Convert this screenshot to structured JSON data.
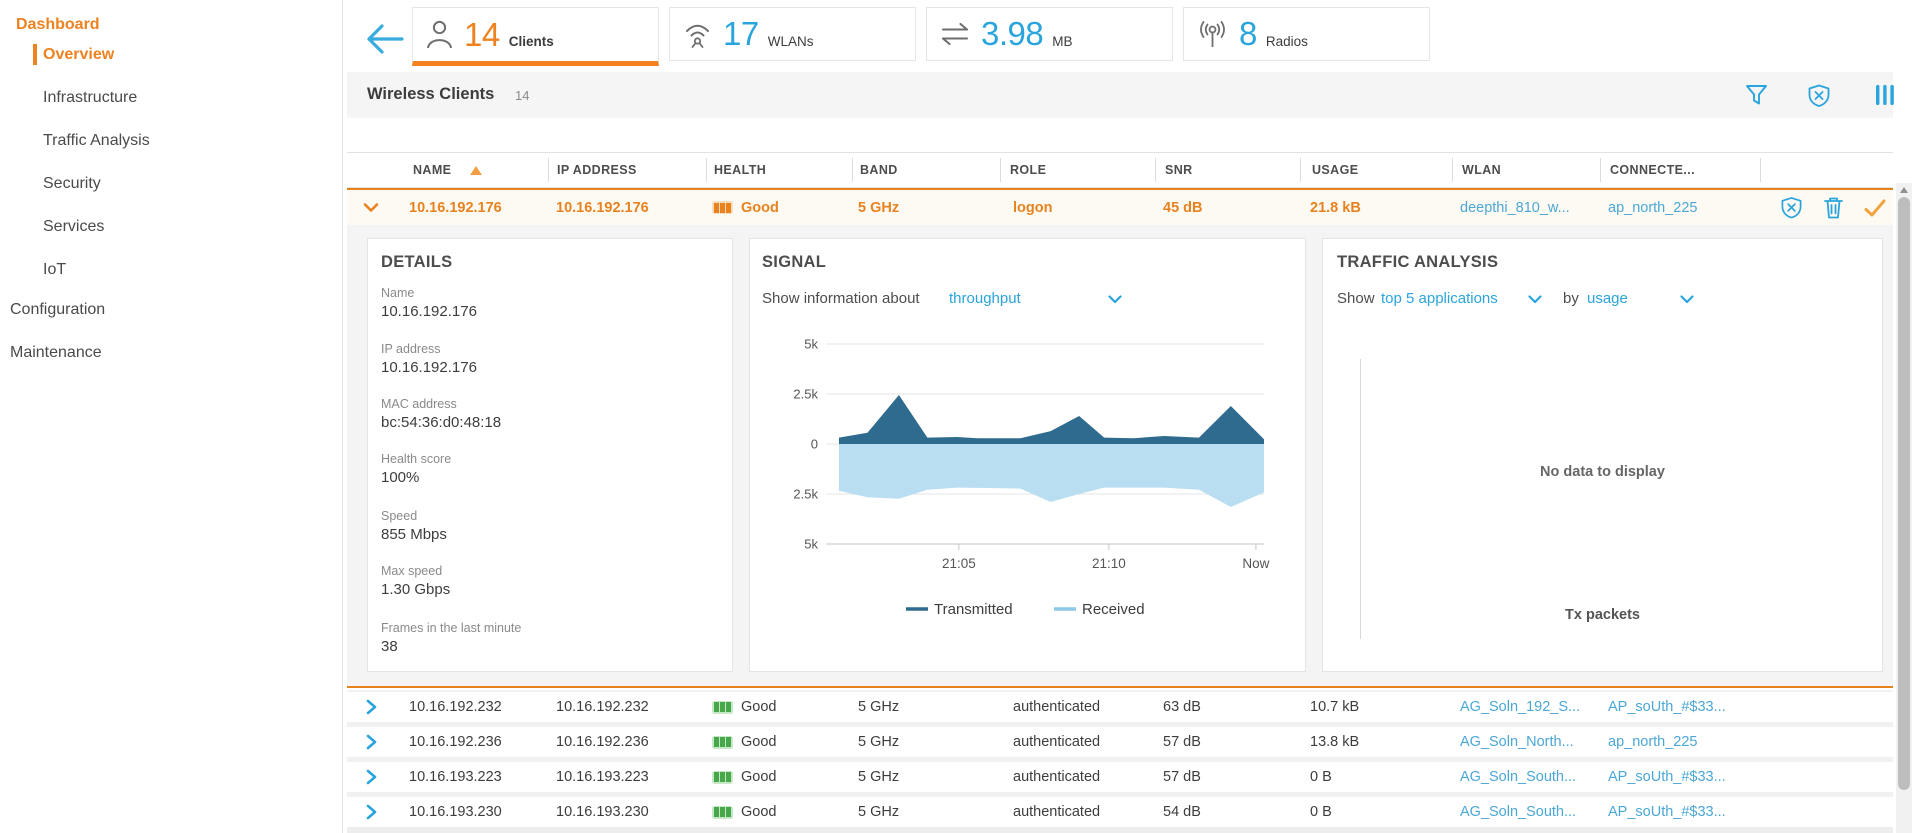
{
  "accent_colors": {
    "orange": "#ef8220",
    "blue": "#2aa4dc",
    "link_blue": "#4ba7d6",
    "green": "#4caf50"
  },
  "sidebar": {
    "items": [
      {
        "label": "Dashboard"
      },
      {
        "label": "Overview"
      },
      {
        "label": "Infrastructure"
      },
      {
        "label": "Traffic Analysis"
      },
      {
        "label": "Security"
      },
      {
        "label": "Services"
      },
      {
        "label": "IoT"
      },
      {
        "label": "Configuration"
      },
      {
        "label": "Maintenance"
      }
    ]
  },
  "stats": {
    "clients": {
      "value": "14",
      "label": "Clients"
    },
    "wlans": {
      "value": "17",
      "label": "WLANs"
    },
    "traffic": {
      "value": "3.98",
      "label": "MB"
    },
    "radios": {
      "value": "8",
      "label": "Radios"
    }
  },
  "table": {
    "title": "Wireless Clients",
    "count": "14",
    "columns": [
      "NAME",
      "IP ADDRESS",
      "HEALTH",
      "BAND",
      "ROLE",
      "SNR",
      "USAGE",
      "WLAN",
      "CONNECTE..."
    ],
    "expanded_row": {
      "name": "10.16.192.176",
      "ip": "10.16.192.176",
      "health": "Good",
      "band": "5 GHz",
      "role": "logon",
      "snr": "45 dB",
      "usage": "21.8 kB",
      "wlan": "deepthi_810_w...",
      "connected": "ap_north_225"
    },
    "rows": [
      {
        "name": "10.16.192.232",
        "ip": "10.16.192.232",
        "health": "Good",
        "band": "5 GHz",
        "role": "authenticated",
        "snr": "63 dB",
        "usage": "10.7 kB",
        "wlan": "AG_Soln_192_S...",
        "connected": "AP_soUth_#$33..."
      },
      {
        "name": "10.16.192.236",
        "ip": "10.16.192.236",
        "health": "Good",
        "band": "5 GHz",
        "role": "authenticated",
        "snr": "57 dB",
        "usage": "13.8 kB",
        "wlan": "AG_Soln_North...",
        "connected": "ap_north_225"
      },
      {
        "name": "10.16.193.223",
        "ip": "10.16.193.223",
        "health": "Good",
        "band": "5 GHz",
        "role": "authenticated",
        "snr": "57 dB",
        "usage": "0 B",
        "wlan": "AG_Soln_South...",
        "connected": "AP_soUth_#$33..."
      },
      {
        "name": "10.16.193.230",
        "ip": "10.16.193.230",
        "health": "Good",
        "band": "5 GHz",
        "role": "authenticated",
        "snr": "54 dB",
        "usage": "0 B",
        "wlan": "AG_Soln_South...",
        "connected": "AP_soUth_#$33..."
      }
    ]
  },
  "details": {
    "title": "DETAILS",
    "fields": [
      {
        "label": "Name",
        "value": "10.16.192.176"
      },
      {
        "label": "IP address",
        "value": "10.16.192.176"
      },
      {
        "label": "MAC address",
        "value": "bc:54:36:d0:48:18"
      },
      {
        "label": "Health score",
        "value": "100%"
      },
      {
        "label": "Speed",
        "value": "855 Mbps"
      },
      {
        "label": "Max speed",
        "value": "1.30 Gbps"
      },
      {
        "label": "Frames in the last minute",
        "value": "38"
      }
    ]
  },
  "signal": {
    "title": "SIGNAL",
    "show_label": "Show information about",
    "metric": "throughput"
  },
  "traffic_analysis": {
    "title": "TRAFFIC ANALYSIS",
    "show_label": "Show",
    "filter1": "top 5 applications",
    "by_label": "by",
    "filter2": "usage",
    "empty_text": "No data to display",
    "xlabel": "Tx packets"
  },
  "chart_data": {
    "type": "area",
    "title": "SIGNAL throughput",
    "ylim": [
      -5000,
      5000
    ],
    "ytick_step": 2500,
    "ytick_labels": [
      "5k",
      "2.5k",
      "0",
      "2.5k",
      "5k"
    ],
    "x_tick_labels": [
      "21:05",
      "21:10",
      "Now"
    ],
    "x_tick_fracs": [
      0.282,
      0.635,
      0.981
    ],
    "series": [
      {
        "name": "Transmitted",
        "color": "#2e6b8f",
        "legend_color": "#2e6b8f",
        "x_fracs": [
          0,
          0.067,
          0.141,
          0.208,
          0.278,
          0.325,
          0.427,
          0.498,
          0.565,
          0.624,
          0.694,
          0.765,
          0.847,
          0.922,
          1
        ],
        "values": [
          320,
          560,
          2450,
          320,
          350,
          290,
          290,
          645,
          1400,
          320,
          290,
          400,
          320,
          1900,
          240
        ]
      },
      {
        "name": "Received",
        "color": "#b9def2",
        "legend_color": "#8cc8ea",
        "x_fracs": [
          0,
          0.067,
          0.141,
          0.208,
          0.278,
          0.35,
          0.427,
          0.498,
          0.565,
          0.624,
          0.694,
          0.765,
          0.847,
          0.922,
          1
        ],
        "values": [
          -2340,
          -2660,
          -2740,
          -2290,
          -2180,
          -2200,
          -2230,
          -2900,
          -2500,
          -2180,
          -2180,
          -2180,
          -2290,
          -3150,
          -2420
        ]
      }
    ]
  }
}
